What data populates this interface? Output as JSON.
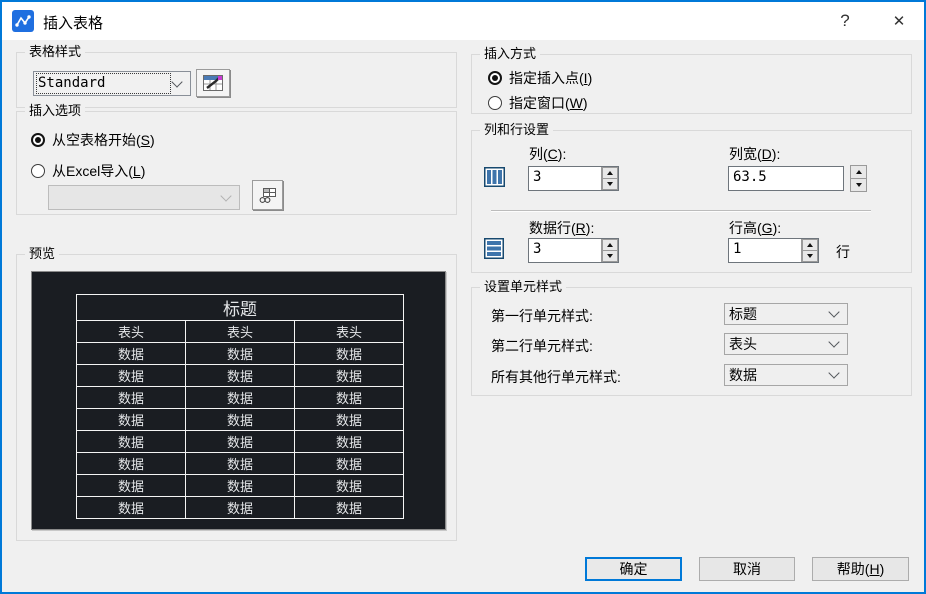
{
  "window": {
    "title": "插入表格",
    "help_glyph": "?",
    "close_glyph": "✕"
  },
  "colors": {
    "accent": "#0079d8",
    "titlebar_bg": "#ffffff",
    "body_bg": "#f0f0f0",
    "preview_bg": "#1a1d22",
    "preview_line": "#f4f4f4"
  },
  "icons": {
    "app": "polyline-nodes-icon",
    "table_style_editor": "table-brush-icon",
    "excel_link": "table-link-icon",
    "columns": "columns-icon",
    "rows": "rows-icon",
    "combo_arrow": "chevron-down-icon",
    "spin_up": "arrow-up-icon",
    "spin_down": "arrow-down-icon"
  },
  "table_style": {
    "group_label": "表格样式",
    "combo_value": "Standard"
  },
  "insert_options": {
    "group_label": "插入选项",
    "radio_empty": "从空表格开始(S)",
    "radio_excel": "从Excel导入(L)",
    "excel_combo_value": ""
  },
  "preview": {
    "group_label": "预览",
    "table": {
      "title": "标题",
      "header": [
        "表头",
        "表头",
        "表头"
      ],
      "data_cell": "数据",
      "data_rows": 8,
      "columns": 3
    }
  },
  "insert_behavior": {
    "group_label": "插入方式",
    "radio_point": "指定插入点(I)",
    "radio_window": "指定窗口(W)"
  },
  "col_row_settings": {
    "group_label": "列和行设置",
    "columns_label": "列(C):",
    "columns_value": "3",
    "col_width_label": "列宽(D):",
    "col_width_value": "63.5",
    "data_rows_label": "数据行(R):",
    "data_rows_value": "3",
    "row_height_label": "行高(G):",
    "row_height_value": "1",
    "row_height_unit": "行"
  },
  "cell_styles": {
    "group_label": "设置单元样式",
    "rows": [
      {
        "label": "第一行单元样式:",
        "value": "标题"
      },
      {
        "label": "第二行单元样式:",
        "value": "表头"
      },
      {
        "label": "所有其他行单元样式:",
        "value": "数据"
      }
    ]
  },
  "footer": {
    "ok": "确定",
    "cancel": "取消",
    "help": "帮助(H)"
  }
}
